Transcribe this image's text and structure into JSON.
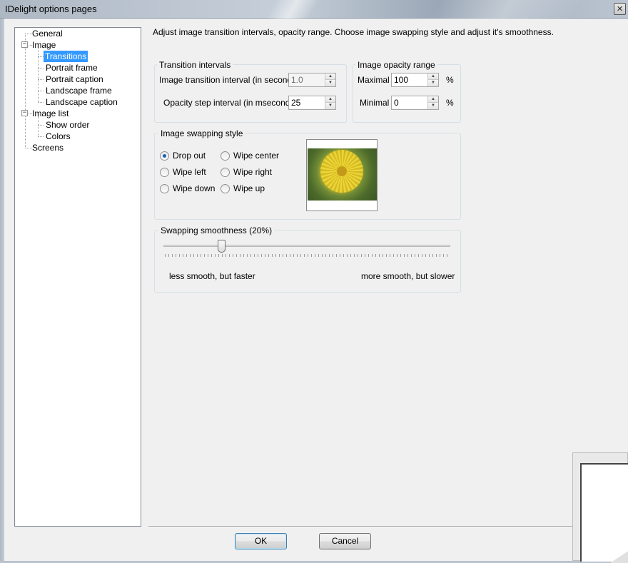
{
  "window": {
    "title": "IDelight options pages",
    "close_glyph": "✕"
  },
  "tree": {
    "items": [
      {
        "label": "General"
      },
      {
        "label": "Image",
        "expander": "−"
      },
      {
        "label": "Transitions",
        "selected": true
      },
      {
        "label": "Portrait frame"
      },
      {
        "label": "Portrait caption"
      },
      {
        "label": "Landscape frame"
      },
      {
        "label": "Landscape caption"
      },
      {
        "label": "Image list",
        "expander": "−"
      },
      {
        "label": "Show order"
      },
      {
        "label": "Colors"
      },
      {
        "label": "Screens"
      }
    ]
  },
  "description": "Adjust image transition intervals, opacity range. Choose image swapping style and adjust it's smoothness.",
  "transition_intervals": {
    "title": "Transition intervals",
    "image_interval_label": "Image transition interval (in seconds)",
    "image_interval_value": "1.0",
    "opacity_step_label": "Opacity step interval (in mseconds)",
    "opacity_step_value": "25"
  },
  "opacity_range": {
    "title": "Image opacity range",
    "maximal_label": "Maximal",
    "maximal_value": "100",
    "minimal_label": "Minimal",
    "minimal_value": "0",
    "unit": "%"
  },
  "swapping_style": {
    "title": "Image swapping style",
    "options": [
      {
        "label": "Drop out",
        "checked": true
      },
      {
        "label": "Wipe center",
        "checked": false
      },
      {
        "label": "Wipe left",
        "checked": false
      },
      {
        "label": "Wipe right",
        "checked": false
      },
      {
        "label": "Wipe down",
        "checked": false
      },
      {
        "label": "Wipe up",
        "checked": false
      }
    ]
  },
  "smoothness": {
    "title": "Swapping smoothness (20%)",
    "value_percent": 20,
    "left_label": "less smooth, but faster",
    "right_label": "more smooth, but slower"
  },
  "buttons": {
    "ok": "OK",
    "cancel": "Cancel"
  },
  "icons": {
    "spin_up": "▲",
    "spin_down": "▼"
  }
}
